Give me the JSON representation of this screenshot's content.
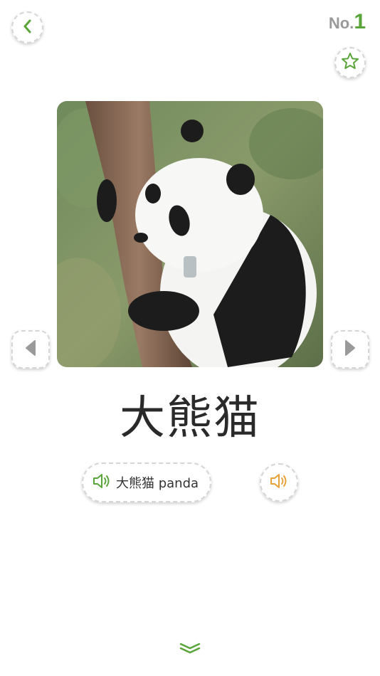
{
  "header": {
    "counter_prefix": "No.",
    "counter_number": "1"
  },
  "card": {
    "word": "大熊猫",
    "pronunciation_label": "大熊猫 panda",
    "image_subject": "giant panda climbing tree"
  },
  "icons": {
    "back": "chevron-left-icon",
    "favorite": "star-icon",
    "previous": "triangle-left-icon",
    "next": "triangle-right-icon",
    "speaker_green": "speaker-icon",
    "speaker_orange": "speaker-icon",
    "expand": "double-chevron-down-icon"
  },
  "colors": {
    "accent_green": "#5aa53a",
    "speaker_orange": "#e8a23c",
    "counter_gray": "#9a9a9a",
    "nav_gray": "#9a9a9a"
  }
}
